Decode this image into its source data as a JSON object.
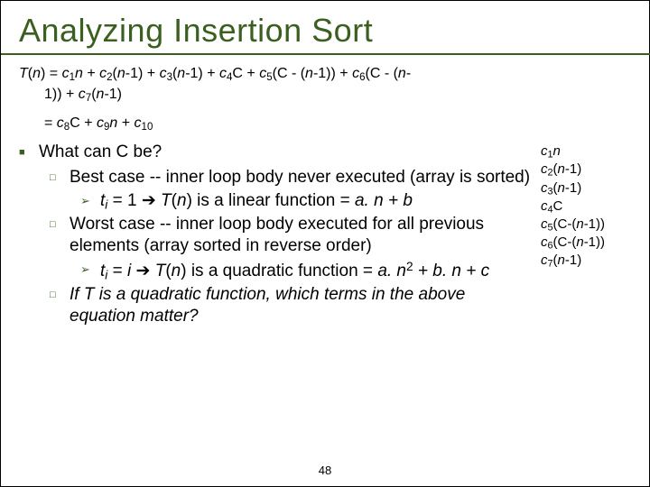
{
  "title": "Analyzing Insertion Sort",
  "eq1_a": "T",
  "eq1_b": "(",
  "eq1_c": "n",
  "eq1_d": ") = ",
  "eq1_e": "c",
  "eq1_f": "1",
  "eq1_g": "n",
  "eq1_h": " + ",
  "eq1_i": "c",
  "eq1_j": "2",
  "eq1_k": "(",
  "eq1_l": "n",
  "eq1_m": "-1) + ",
  "eq1_n": "c",
  "eq1_o": "3",
  "eq1_p": "(",
  "eq1_q": "n",
  "eq1_r": "-1) + ",
  "eq1_s": "c",
  "eq1_t": "4",
  "eq1_u": "C + ",
  "eq1_v": "c",
  "eq1_w": "5",
  "eq1_x": "(C - (",
  "eq1_y": "n",
  "eq1_z": "-1)) + ",
  "eq1_A": "c",
  "eq1_B": "6",
  "eq1_C": "(C - (",
  "eq1_D": "n",
  "eq1_E": "-",
  "eq1_line2a": "1)) + ",
  "eq1_line2b": "c",
  "eq1_line2c": "7",
  "eq1_line2d": "(",
  "eq1_line2e": "n",
  "eq1_line2f": "-1)",
  "eq2_a": "= ",
  "eq2_b": "c",
  "eq2_c": "8",
  "eq2_d": "C + ",
  "eq2_e": "c",
  "eq2_f": "9",
  "eq2_g": "n",
  "eq2_h": " + ",
  "eq2_i": "c",
  "eq2_j": "10",
  "q_what": "What can C be?",
  "best_a": "Best case -- inner loop body never executed (array is sorted)",
  "best_sub_a": "t",
  "best_sub_b": "i",
  "best_sub_c": " = 1",
  "best_sub_d": "T",
  "best_sub_e": "(",
  "best_sub_f": "n",
  "best_sub_g": ") is a linear function = ",
  "best_sub_h": "a. n + b",
  "worst_a": "Worst case -- inner loop body executed for all previous elements (array sorted in reverse order)",
  "worst_sub_a": "t",
  "worst_sub_b": "i",
  "worst_sub_c": " = ",
  "worst_sub_d": "i",
  "worst_sub_e": "T",
  "worst_sub_f": "(",
  "worst_sub_g": "n",
  "worst_sub_h": ") is a quadratic function = ",
  "worst_sub_i": "a. n",
  "worst_sub_j": "2",
  "worst_sub_k": " + b. n + c",
  "ifT": "If T is a quadratic function, which terms in the above equation matter?",
  "side1a": "c",
  "side1b": "1",
  "side1c": "n",
  "side2a": "c",
  "side2b": "2",
  "side2c": "(",
  "side2d": "n",
  "side2e": "-1)",
  "side3a": "c",
  "side3b": "3",
  "side3c": "(",
  "side3d": "n",
  "side3e": "-1)",
  "side4a": "c",
  "side4b": "4",
  "side4c": "C",
  "side5a": "c",
  "side5b": "5",
  "side5c": "(C-(",
  "side5d": "n",
  "side5e": "-1))",
  "side6a": "c",
  "side6b": "6",
  "side6c": "(C-(",
  "side6d": "n",
  "side6e": "-1))",
  "side7a": "c",
  "side7b": "7",
  "side7c": "(",
  "side7d": "n",
  "side7e": "-1)",
  "pagenum": "48"
}
